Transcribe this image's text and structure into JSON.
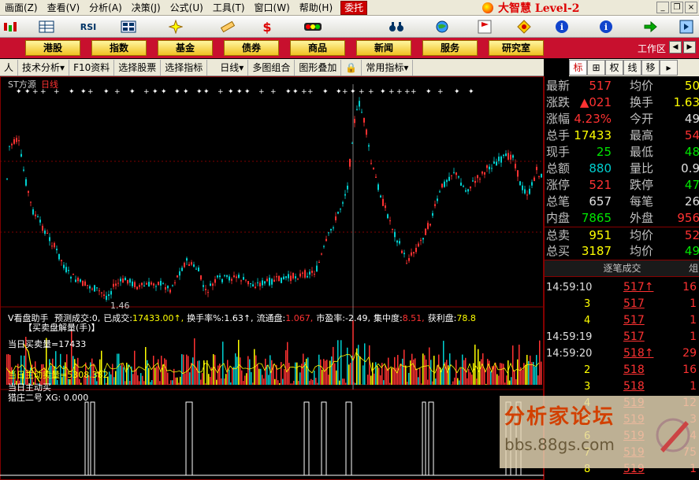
{
  "menu": {
    "items": [
      "画面(Z)",
      "查看(V)",
      "分析(A)",
      "决策(J)",
      "公式(U)",
      "工具(T)",
      "窗口(W)",
      "帮助(H)"
    ],
    "weituo": "委托",
    "brand": "大智慧 Level-2"
  },
  "toolbar": {
    "rsi": "RSI",
    "dollar": "$"
  },
  "quickbar": {
    "buttons": [
      "港股",
      "指数",
      "基金",
      "债券",
      "商品",
      "新闻",
      "服务",
      "研究室"
    ],
    "workarea": "工作区"
  },
  "funcbar": {
    "items": [
      "人",
      "技术分析",
      "F10资料",
      "选择股票",
      "选择指标",
      "日线",
      "多图组合",
      "图形叠加",
      "常用指标"
    ]
  },
  "right_tabs": [
    "标",
    "⊞",
    "权",
    "线",
    "移"
  ],
  "chart": {
    "title_name": "ST方源",
    "title_period": "日线",
    "low_label": "1.46",
    "indicator1_name": "V看盘助手",
    "indicator1_items": [
      {
        "label": "预测成交:",
        "value": "0,",
        "color": "#ffffff"
      },
      {
        "label": "已成交:",
        "value": "17433.00↑,",
        "color": "#ffff00"
      },
      {
        "label": "换手率%:",
        "value": "1.63↑,",
        "color": "#ffffff"
      },
      {
        "label": "流通盘:",
        "value": "1.067,",
        "color": "#ff3232"
      },
      {
        "label": "市盈率:",
        "value": "-2.49,",
        "color": "#ffffff"
      },
      {
        "label": "集中度:",
        "value": "8.51,",
        "color": "#ff3232"
      },
      {
        "label": "获利盘:",
        "value": "78.8",
        "color": "#ffff00"
      }
    ],
    "sub_header": "【买卖盘解量(手)】",
    "day_volume": "当日买卖量=17433",
    "active_sell": "当日主动卖量=5308.382",
    "active_buy": "当日主动买",
    "indicator2": "猎庄二号 XG: 0.000"
  },
  "quote": {
    "rows": [
      {
        "l1": "最新",
        "v1": "517",
        "c1": "red",
        "l2": "均价",
        "v2": "50",
        "c2": "yel"
      },
      {
        "l1": "涨跌",
        "v1": "▲021",
        "c1": "red",
        "l2": "换手",
        "v2": "1.63",
        "c2": "yel"
      },
      {
        "l1": "涨幅",
        "v1": "4.23%",
        "c1": "red",
        "l2": "今开",
        "v2": "49",
        "c2": "wht"
      },
      {
        "l1": "总手",
        "v1": "17433",
        "c1": "yel",
        "l2": "最高",
        "v2": "54",
        "c2": "red"
      },
      {
        "l1": "现手",
        "v1": "25",
        "c1": "grn",
        "l2": "最低",
        "v2": "48",
        "c2": "grn"
      },
      {
        "l1": "总额",
        "v1": "880",
        "c1": "cyn",
        "l2": "量比",
        "v2": "0.9",
        "c2": "wht"
      },
      {
        "l1": "涨停",
        "v1": "521",
        "c1": "red",
        "l2": "跌停",
        "v2": "47",
        "c2": "grn"
      },
      {
        "l1": "总笔",
        "v1": "657",
        "c1": "wht",
        "l2": "每笔",
        "v2": "26",
        "c2": "wht"
      },
      {
        "l1": "内盘",
        "v1": "7865",
        "c1": "grn",
        "l2": "外盘",
        "v2": "956",
        "c2": "red"
      },
      {
        "l1": "总卖",
        "v1": "951",
        "c1": "yel",
        "l2": "均价",
        "v2": "52",
        "c2": "red"
      },
      {
        "l1": "总买",
        "v1": "3187",
        "c1": "yel",
        "l2": "均价",
        "v2": "49",
        "c2": "grn"
      }
    ],
    "tick_header": "逐笔成交",
    "tick_header_right": "俎",
    "ticks": [
      {
        "t": "14:59:10",
        "p": "517↑",
        "v": "16"
      },
      {
        "t": "3",
        "p": "517",
        "v": "1"
      },
      {
        "t": "4",
        "p": "517",
        "v": "1"
      },
      {
        "t": "14:59:19",
        "p": "517",
        "v": "1"
      },
      {
        "t": "14:59:20",
        "p": "518↑",
        "v": "29"
      },
      {
        "t": "2",
        "p": "518",
        "v": "16"
      },
      {
        "t": "3",
        "p": "518",
        "v": "1"
      },
      {
        "t": "4",
        "p": "519",
        "v": "12"
      },
      {
        "t": "5",
        "p": "519",
        "v": "3"
      },
      {
        "t": "6",
        "p": "519",
        "v": "4"
      },
      {
        "t": "7",
        "p": "519",
        "v": "75"
      },
      {
        "t": "8",
        "p": "519",
        "v": "1"
      }
    ]
  },
  "watermark": {
    "main": "分析家论坛",
    "url": "bbs.88gs.com"
  },
  "colors": {
    "menu_bg": "#ece9d8",
    "quickbar_bg": "#c8102e",
    "up": "#ff3232",
    "down": "#00d0d0",
    "grid": "#800000"
  }
}
